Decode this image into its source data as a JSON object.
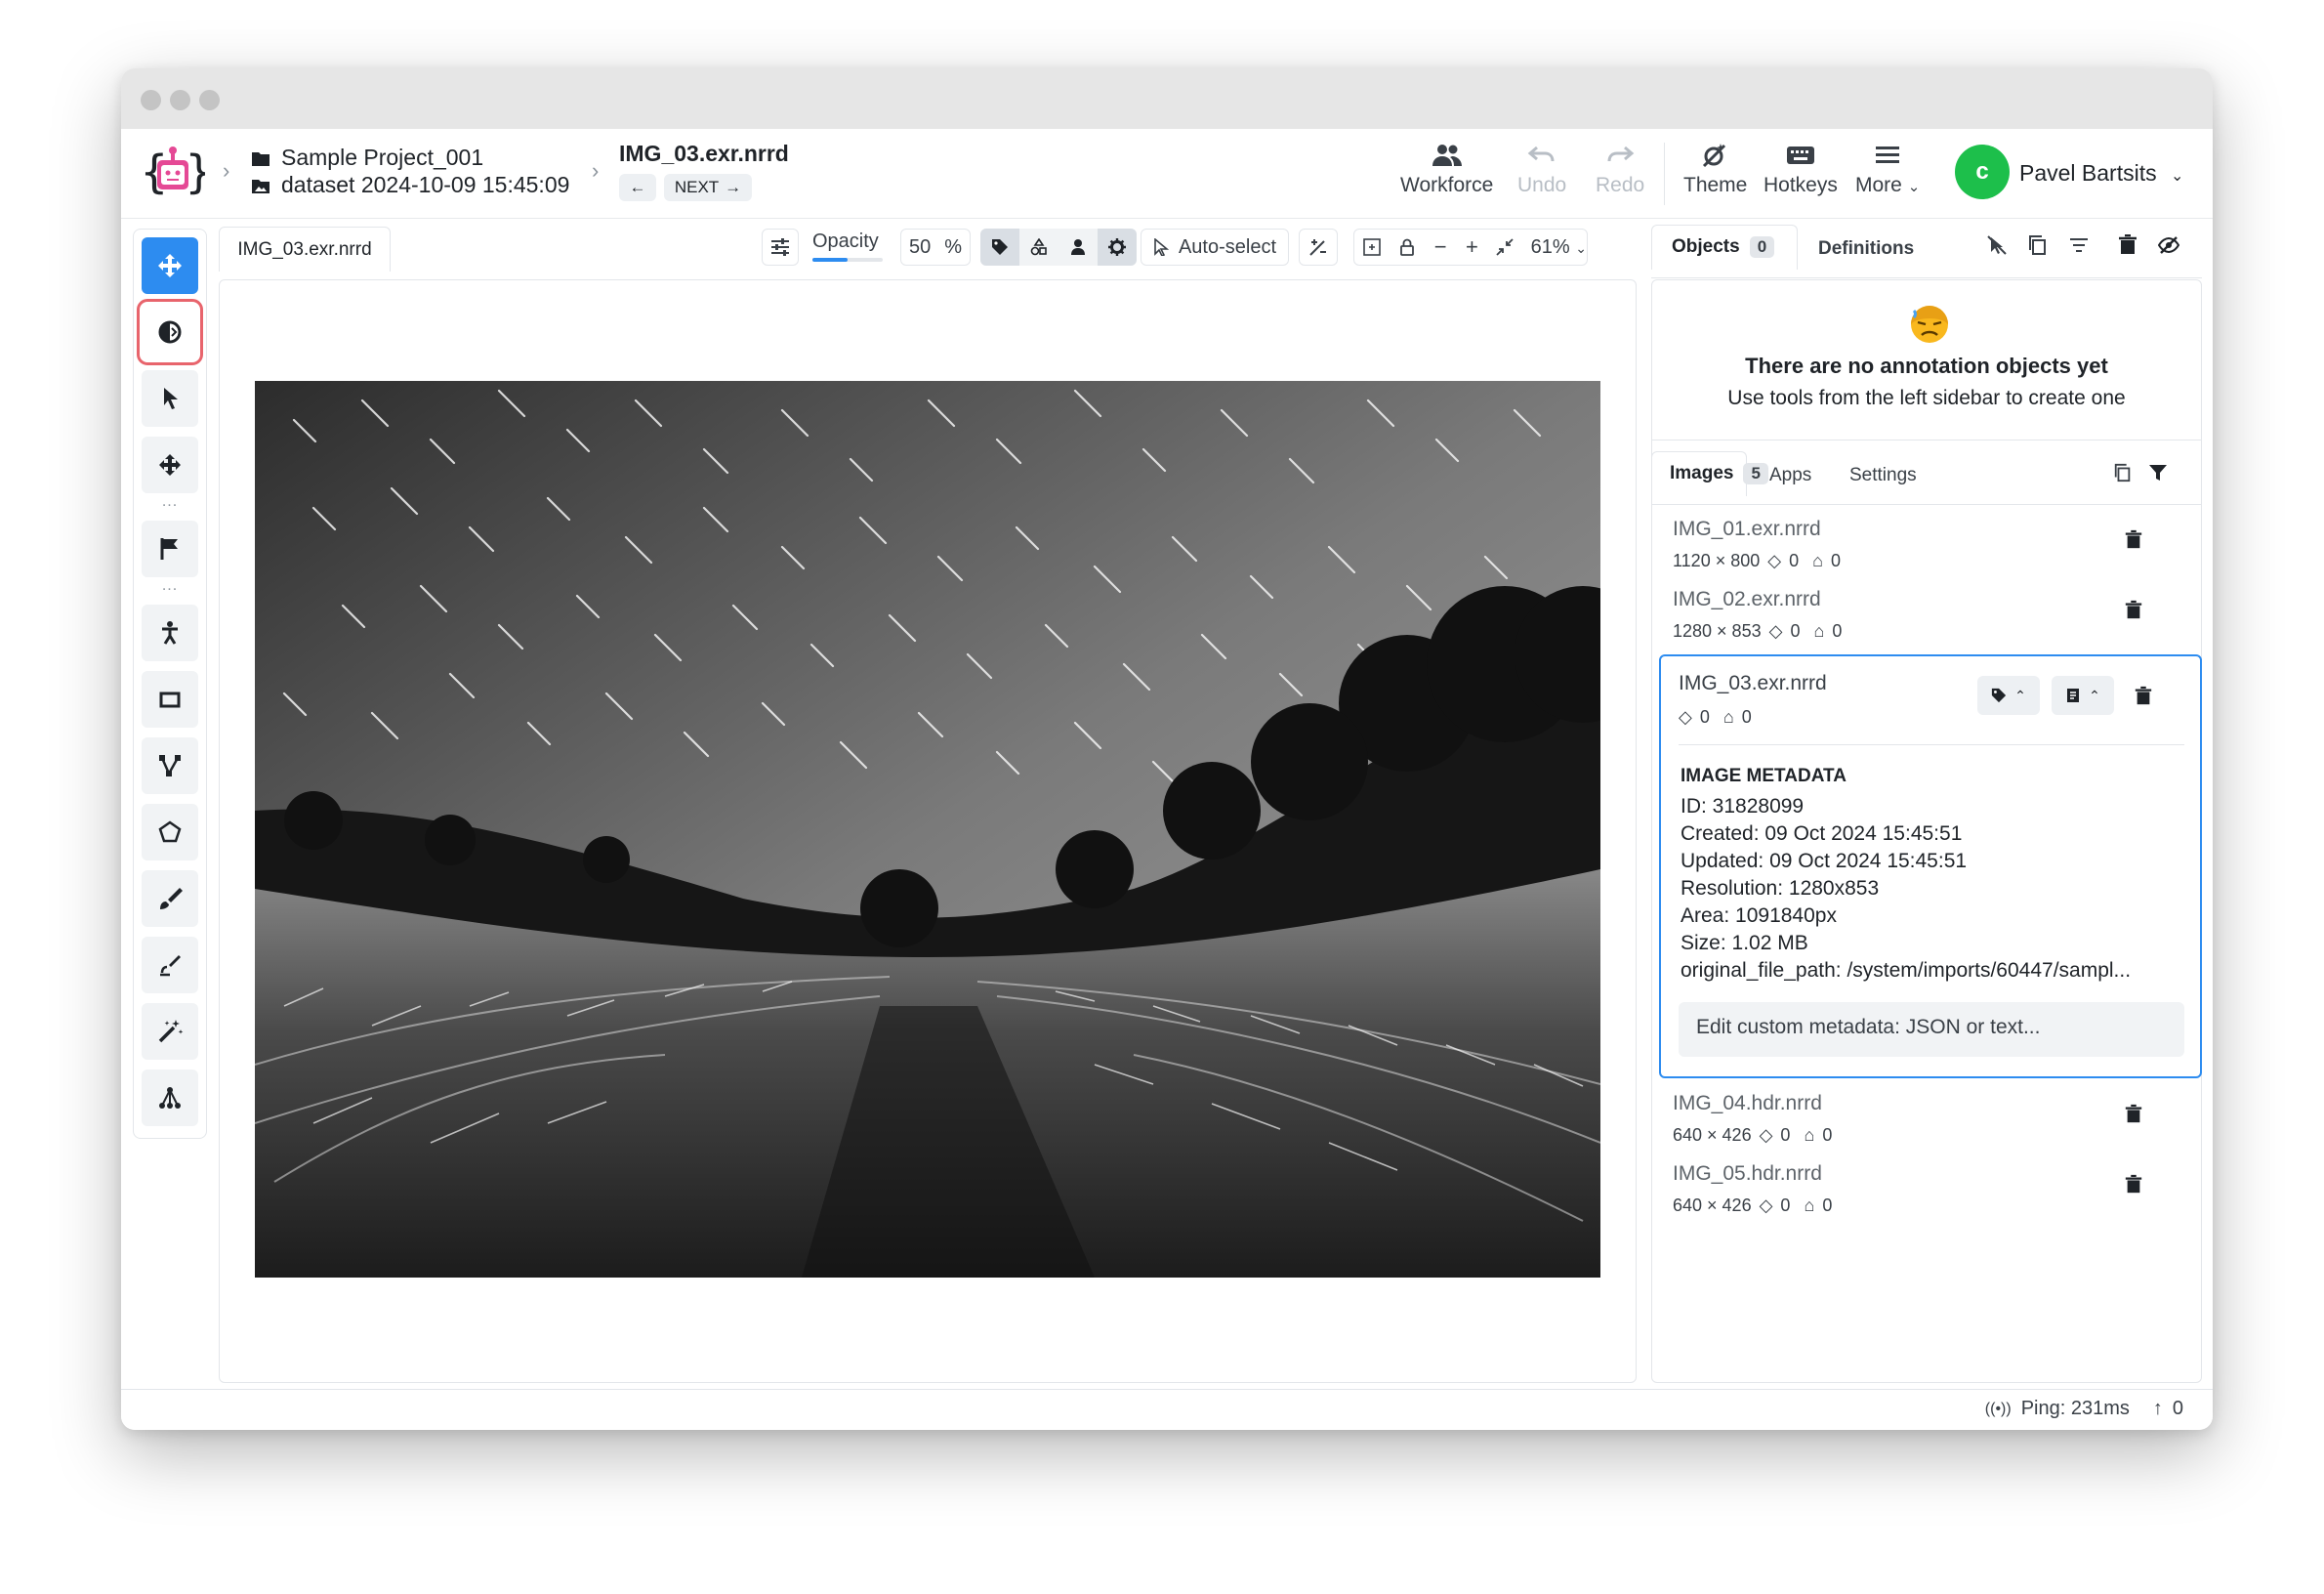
{
  "header": {
    "project": "Sample Project_001",
    "dataset": "dataset 2024-10-09 15:45:09",
    "file_title": "IMG_03.exr.nrrd",
    "next_label": "NEXT",
    "buttons": {
      "workforce": "Workforce",
      "undo": "Undo",
      "redo": "Redo",
      "theme": "Theme",
      "hotkeys": "Hotkeys",
      "more": "More"
    },
    "user_initial": "c",
    "user_name": "Pavel Bartsits"
  },
  "toolbar": {
    "file_tab": "IMG_03.exr.nrrd",
    "opacity_label": "Opacity",
    "opacity_value": "50",
    "opacity_unit": "%",
    "auto_select": "Auto-select",
    "zoom": "61%"
  },
  "right": {
    "tabs_top": {
      "objects": "Objects",
      "objects_count": "0",
      "definitions": "Definitions"
    },
    "empty_title": "There are no annotation objects yet",
    "empty_sub": "Use tools from the left sidebar to create one",
    "tabs_mid": {
      "images": "Images",
      "images_count": "5",
      "apps": "Apps",
      "settings": "Settings"
    },
    "images": [
      {
        "name": "IMG_01.exr.nrrd",
        "res": "1120 × 800",
        "layers": "0",
        "tags": "0"
      },
      {
        "name": "IMG_02.exr.nrrd",
        "res": "1280 × 853",
        "layers": "0",
        "tags": "0"
      },
      {
        "name": "IMG_03.exr.nrrd",
        "res": "",
        "layers": "0",
        "tags": "0"
      },
      {
        "name": "IMG_04.hdr.nrrd",
        "res": "640 × 426",
        "layers": "0",
        "tags": "0"
      },
      {
        "name": "IMG_05.hdr.nrrd",
        "res": "640 × 426",
        "layers": "0",
        "tags": "0"
      }
    ],
    "metadata": {
      "heading": "IMAGE METADATA",
      "id": "ID: 31828099",
      "created": "Created: 09 Oct 2024 15:45:51",
      "updated": "Updated: 09 Oct 2024 15:45:51",
      "resolution": "Resolution: 1280x853",
      "area": "Area: 1091840px",
      "size": "Size: 1.02 MB",
      "path": "original_file_path: /system/imports/60447/sampl...",
      "placeholder": "Edit custom metadata: JSON or text..."
    }
  },
  "footer": {
    "ping": "Ping: 231ms",
    "uploads": "0"
  },
  "colors": {
    "accent": "#2d8cf0",
    "highlight": "#e8646c",
    "avatar": "#1dbf4b"
  }
}
